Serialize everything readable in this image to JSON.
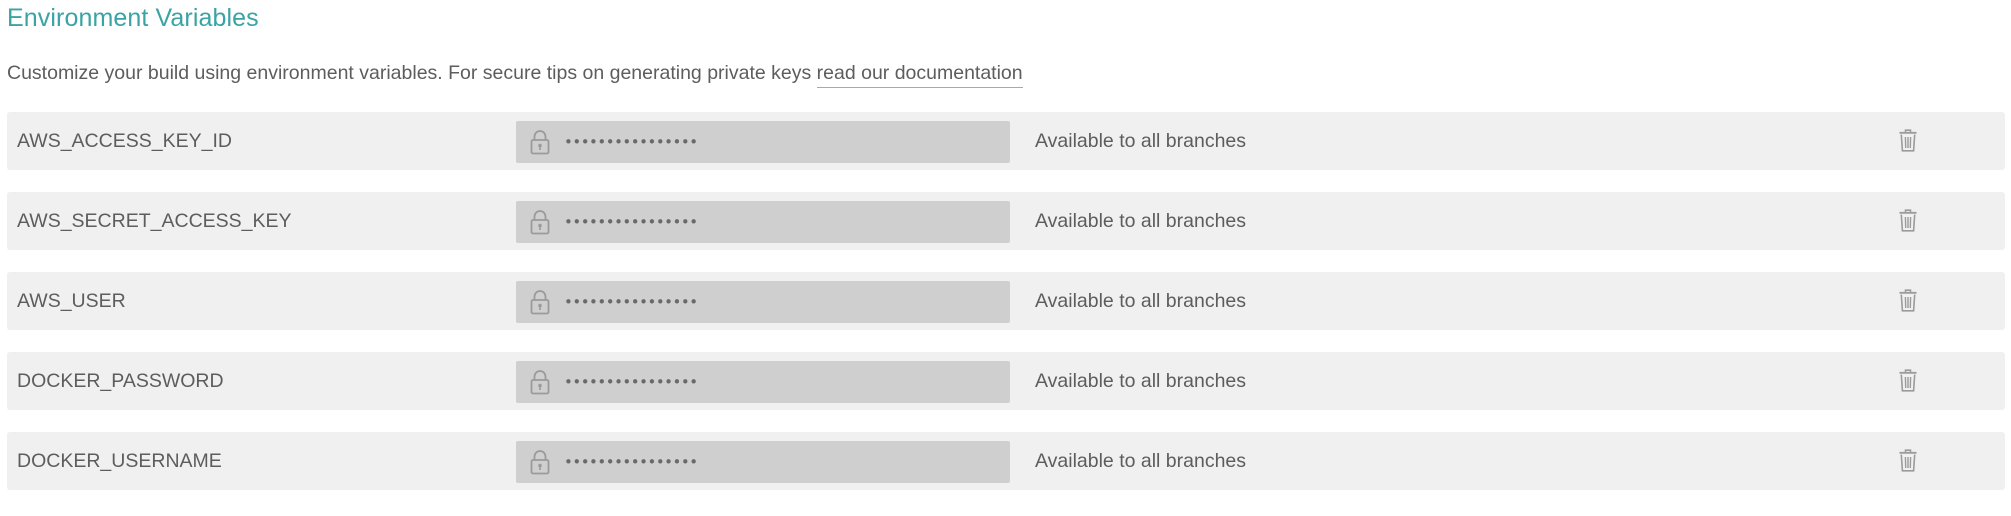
{
  "section": {
    "title": "Environment Variables",
    "description": "Customize your build using environment variables. For secure tips on generating private keys ",
    "doc_link": "read our documentation"
  },
  "variables": [
    {
      "name": "AWS_ACCESS_KEY_ID",
      "masked_value": "••••••••••••••••",
      "availability": "Available to all branches"
    },
    {
      "name": "AWS_SECRET_ACCESS_KEY",
      "masked_value": "••••••••••••••••",
      "availability": "Available to all branches"
    },
    {
      "name": "AWS_USER",
      "masked_value": "••••••••••••••••",
      "availability": "Available to all branches"
    },
    {
      "name": "DOCKER_PASSWORD",
      "masked_value": "••••••••••••••••",
      "availability": "Available to all branches"
    },
    {
      "name": "DOCKER_USERNAME",
      "masked_value": "••••••••••••••••",
      "availability": "Available to all branches"
    }
  ],
  "icons": {
    "secret_field": "lock-icon",
    "delete": "trash-icon"
  },
  "colors": {
    "title": "#3aa3a3",
    "row_background": "#f0f0f0",
    "secret_field_background": "#cfcfcf",
    "text": "#5d5d5d",
    "icon": "#9b9b9b"
  }
}
